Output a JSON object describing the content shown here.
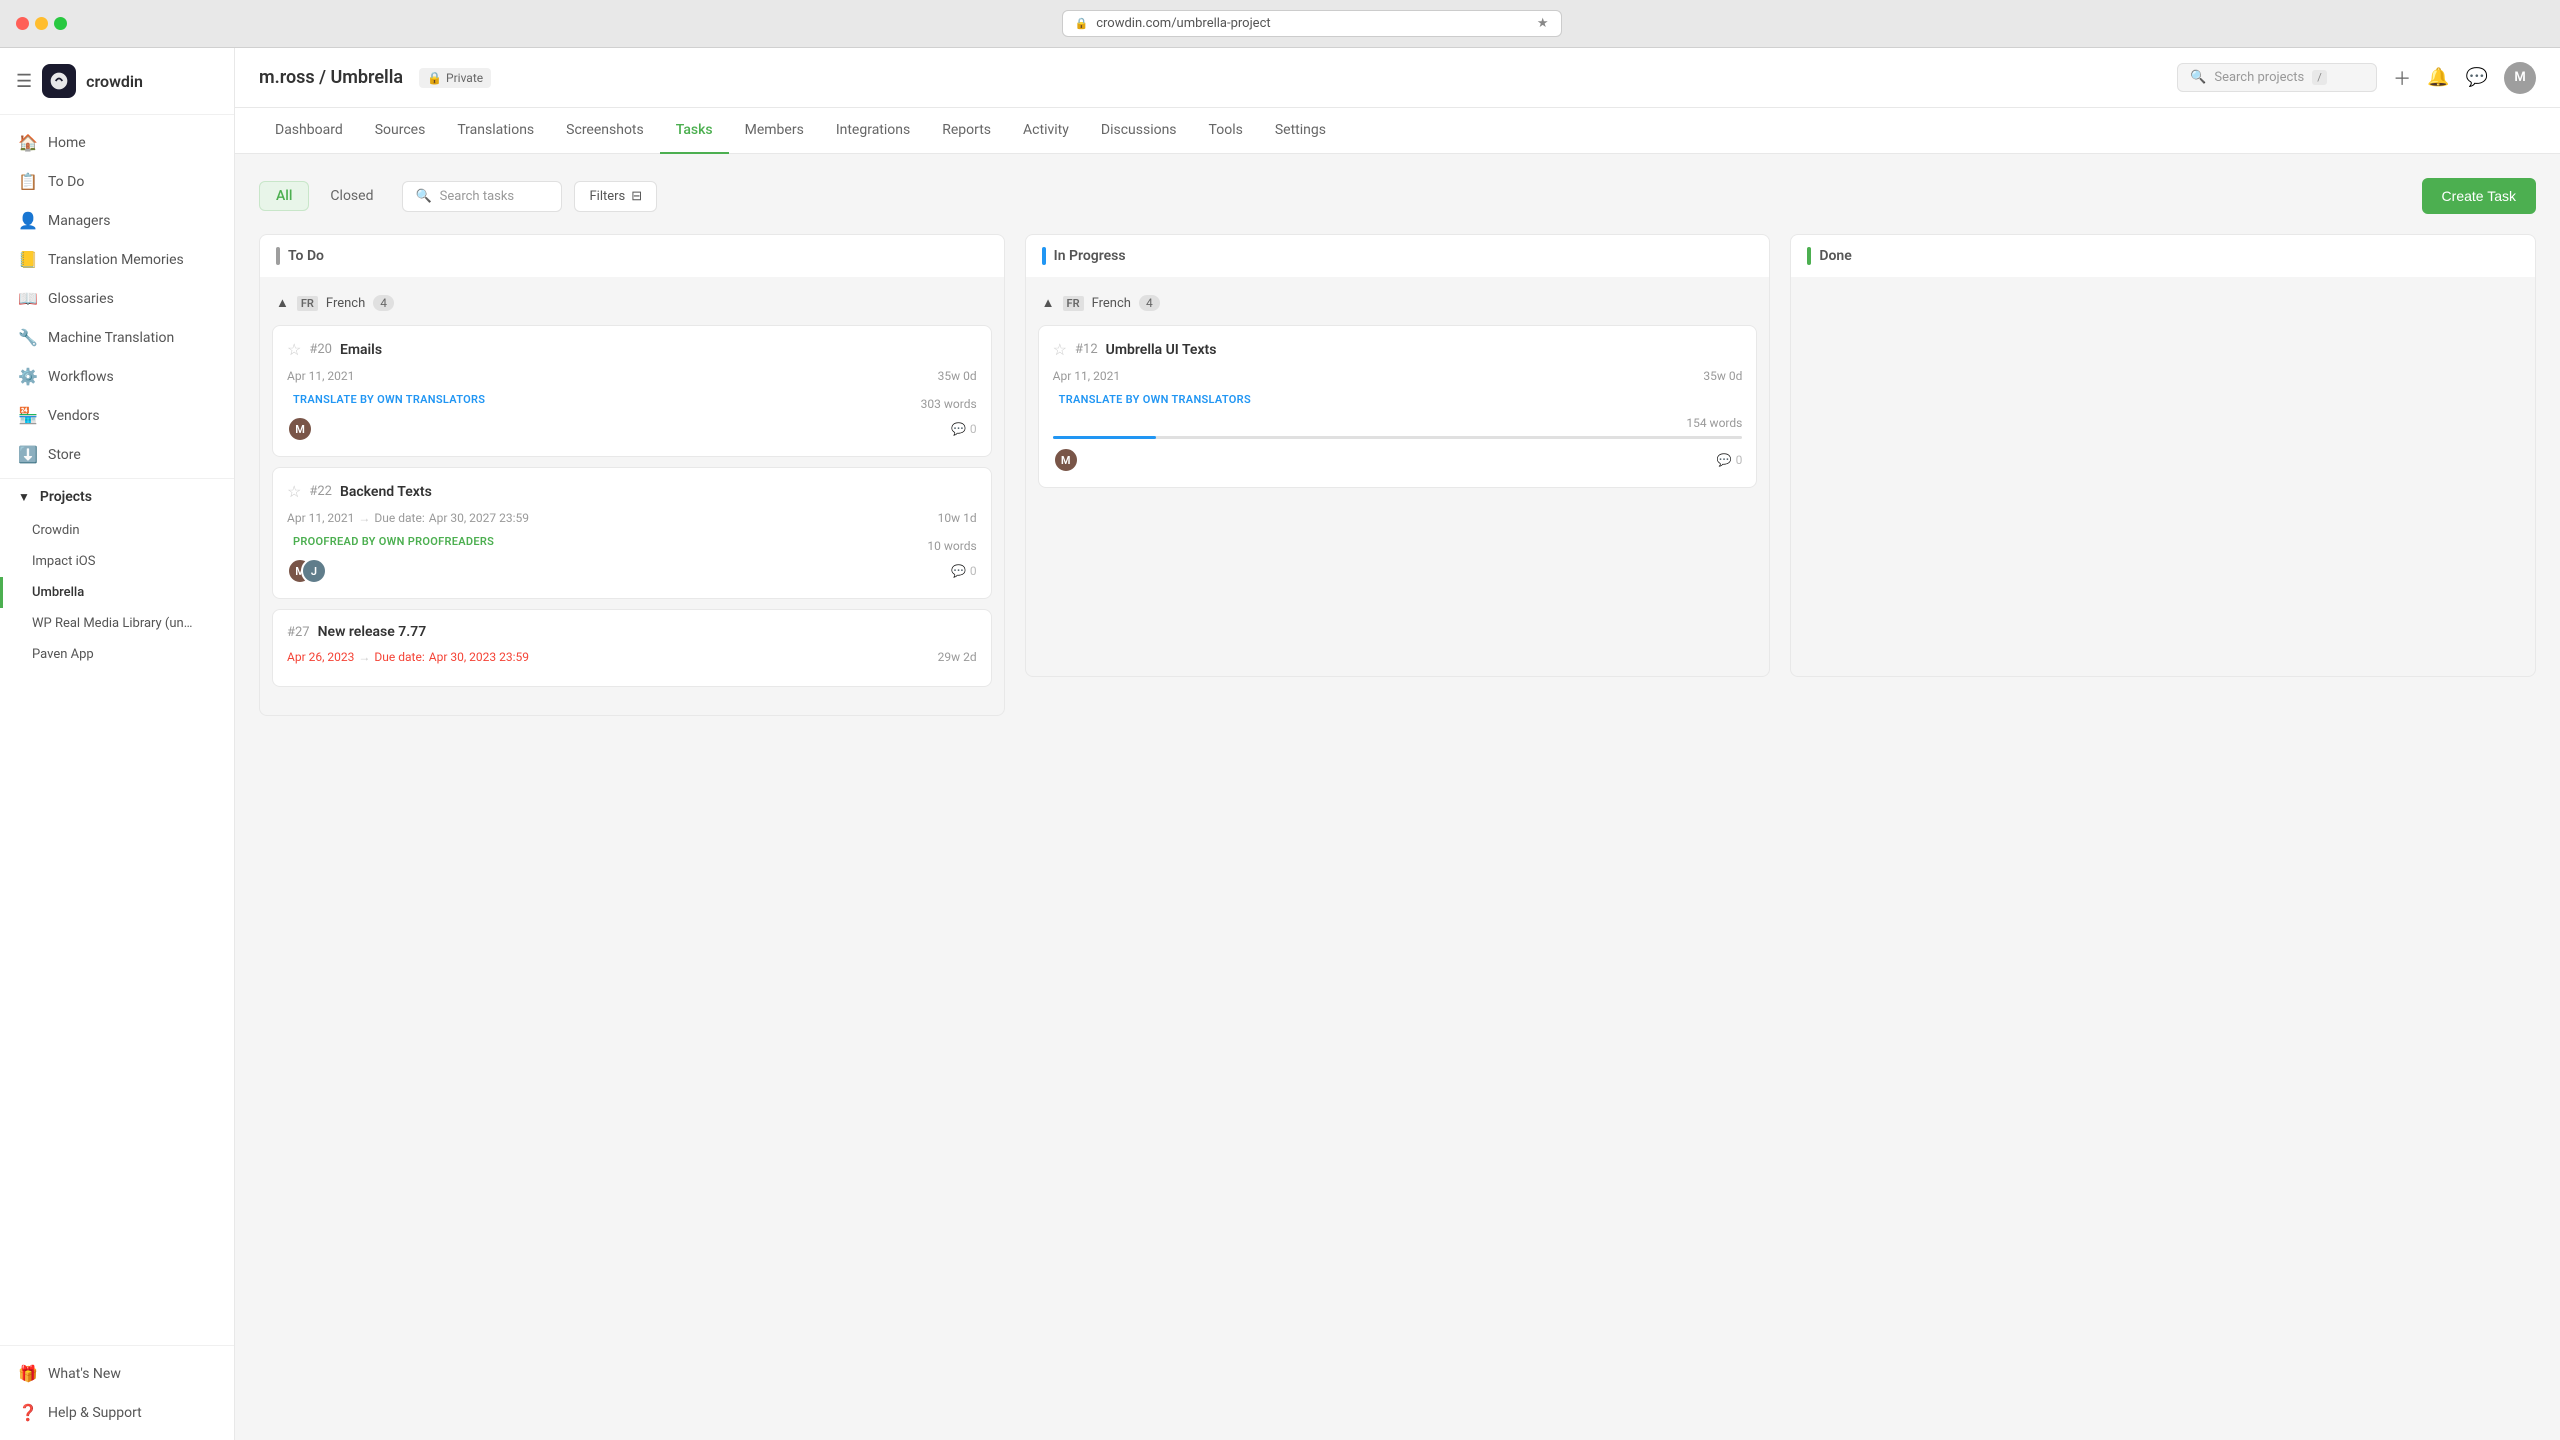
{
  "browser": {
    "url": "crowdin.com/umbrella-project",
    "favicon": "🔒"
  },
  "sidebar": {
    "brand": "crowdin",
    "logo_char": "C",
    "nav_items": [
      {
        "id": "home",
        "label": "Home",
        "icon": "🏠"
      },
      {
        "id": "todo",
        "label": "To Do",
        "icon": "📋"
      },
      {
        "id": "managers",
        "label": "Managers",
        "icon": "👤"
      },
      {
        "id": "translation-memories",
        "label": "Translation Memories",
        "icon": "📒"
      },
      {
        "id": "glossaries",
        "label": "Glossaries",
        "icon": "📖"
      },
      {
        "id": "machine-translation",
        "label": "Machine Translation",
        "icon": "🔧"
      },
      {
        "id": "workflows",
        "label": "Workflows",
        "icon": "⚙️"
      },
      {
        "id": "vendors",
        "label": "Vendors",
        "icon": "🏪"
      },
      {
        "id": "store",
        "label": "Store",
        "icon": "⬇️"
      }
    ],
    "projects_label": "Projects",
    "projects": [
      {
        "id": "crowdin",
        "label": "Crowdin",
        "active": false
      },
      {
        "id": "impact-ios",
        "label": "Impact iOS",
        "active": false
      },
      {
        "id": "umbrella",
        "label": "Umbrella",
        "active": true
      },
      {
        "id": "wp-real-media",
        "label": "WP Real Media Library (un…",
        "active": false
      },
      {
        "id": "paven-app",
        "label": "Paven App",
        "active": false
      }
    ],
    "bottom_items": [
      {
        "id": "whats-new",
        "label": "What's New",
        "icon": "🎁"
      },
      {
        "id": "help-support",
        "label": "Help & Support",
        "icon": "❓"
      }
    ]
  },
  "topbar": {
    "project_path": "m.ross / Umbrella",
    "privacy": "Private",
    "search_placeholder": "Search projects",
    "slash_key": "/",
    "avatar_initials": "M"
  },
  "nav_tabs": {
    "items": [
      {
        "id": "dashboard",
        "label": "Dashboard",
        "active": false
      },
      {
        "id": "sources",
        "label": "Sources",
        "active": false
      },
      {
        "id": "translations",
        "label": "Translations",
        "active": false
      },
      {
        "id": "screenshots",
        "label": "Screenshots",
        "active": false
      },
      {
        "id": "tasks",
        "label": "Tasks",
        "active": true
      },
      {
        "id": "members",
        "label": "Members",
        "active": false
      },
      {
        "id": "integrations",
        "label": "Integrations",
        "active": false
      },
      {
        "id": "reports",
        "label": "Reports",
        "active": false
      },
      {
        "id": "activity",
        "label": "Activity",
        "active": false
      },
      {
        "id": "discussions",
        "label": "Discussions",
        "active": false
      },
      {
        "id": "tools",
        "label": "Tools",
        "active": false
      },
      {
        "id": "settings",
        "label": "Settings",
        "active": false
      }
    ]
  },
  "filters": {
    "tabs": [
      {
        "id": "all",
        "label": "All",
        "active": true
      },
      {
        "id": "closed",
        "label": "Closed",
        "active": false
      }
    ],
    "search_placeholder": "Search tasks",
    "filters_label": "Filters",
    "create_task_label": "Create Task"
  },
  "kanban": {
    "columns": [
      {
        "id": "todo",
        "label": "To Do",
        "indicator": "todo",
        "language_groups": [
          {
            "lang_code": "FR",
            "lang_name": "French",
            "count": 4,
            "tasks": [
              {
                "id": "#20",
                "title": "Emails",
                "starred": false,
                "date": "Apr 11, 2021",
                "due_date": null,
                "time_ago": "35w 0d",
                "badge": "TRANSLATE BY OWN TRANSLATORS",
                "badge_type": "translate",
                "words": "303 words",
                "assignees": [
                  "M"
                ],
                "comments": 0,
                "progress": null,
                "overdue": false
              },
              {
                "id": "#22",
                "title": "Backend Texts",
                "starred": false,
                "date": "Apr 11, 2021",
                "due_date": "Apr 30, 2027 23:59",
                "time_ago": "10w 1d",
                "badge": "PROOFREAD BY OWN PROOFREADERS",
                "badge_type": "proofread",
                "words": "10 words",
                "assignees": [
                  "M",
                  "J"
                ],
                "comments": 0,
                "progress": null,
                "overdue": false
              },
              {
                "id": "#27",
                "title": "New release 7.77",
                "starred": false,
                "date": "Apr 26, 2023",
                "due_date": "Apr 30, 2023 23:59",
                "time_ago": "29w 2d",
                "badge": null,
                "badge_type": null,
                "words": null,
                "assignees": [],
                "comments": 0,
                "progress": null,
                "overdue": true
              }
            ]
          }
        ]
      },
      {
        "id": "in-progress",
        "label": "In Progress",
        "indicator": "progress",
        "language_groups": [
          {
            "lang_code": "FR",
            "lang_name": "French",
            "count": 4,
            "tasks": [
              {
                "id": "#12",
                "title": "Umbrella UI Texts",
                "starred": false,
                "date": "Apr 11, 2021",
                "due_date": null,
                "time_ago": "35w 0d",
                "badge": "TRANSLATE BY OWN TRANSLATORS",
                "badge_type": "translate",
                "words": "154 words",
                "assignees": [
                  "M"
                ],
                "comments": 0,
                "progress": 15,
                "overdue": false
              }
            ]
          }
        ]
      },
      {
        "id": "done",
        "label": "Done",
        "indicator": "done",
        "language_groups": []
      }
    ]
  }
}
